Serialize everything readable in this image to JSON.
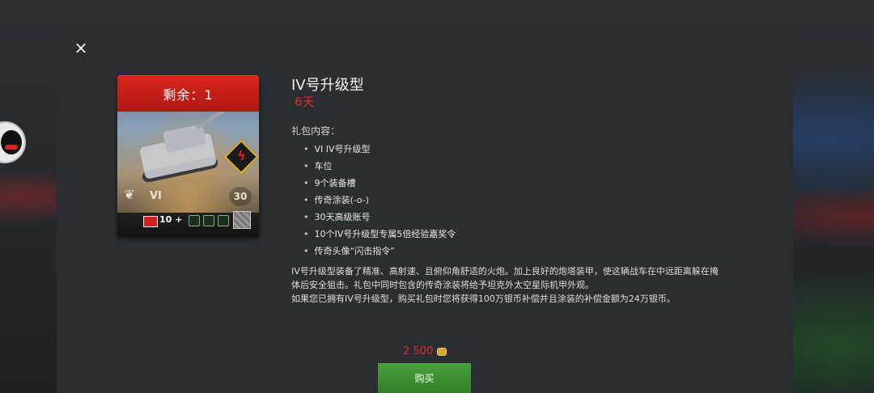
{
  "modal": {
    "close_icon": "×",
    "card": {
      "ribbon": "剩余：1",
      "tier": "VI",
      "days_badge": "30",
      "chip_count": "10 +"
    },
    "title": "IV号升级型",
    "time_left": "6天",
    "contents_label": "礼包内容：",
    "contents": [
      "VI IV号升级型",
      "车位",
      "9个装备槽",
      "传奇涂装(-o-)",
      "30天高级账号",
      "10个IV号升级型专属5倍经验嘉奖令",
      "传奇头像“闪击指令”"
    ],
    "description": [
      "IV号升级型装备了精准、高射速、且俯仰角舒适的火炮。加上良好的炮塔装甲，使这辆战车在中远距离躲在掩",
      "体后安全狙击。礼包中同时包含的传奇涂装将给予坦克外太空星际机甲外观。",
      "如果您已拥有IV号升级型，购买礼包时您将获得100万银币补偿并且涂装的补偿金额为24万银币。"
    ],
    "price": "2 500",
    "buy_label": "购买"
  },
  "colors": {
    "accent_red": "#e02b2b",
    "buy_green": "#3a9130",
    "ribbon_red": "#c81f18"
  },
  "icons": {
    "close": "close-icon",
    "currency": "gold-coin-icon",
    "card_badge": "lightning-shield-icon"
  }
}
